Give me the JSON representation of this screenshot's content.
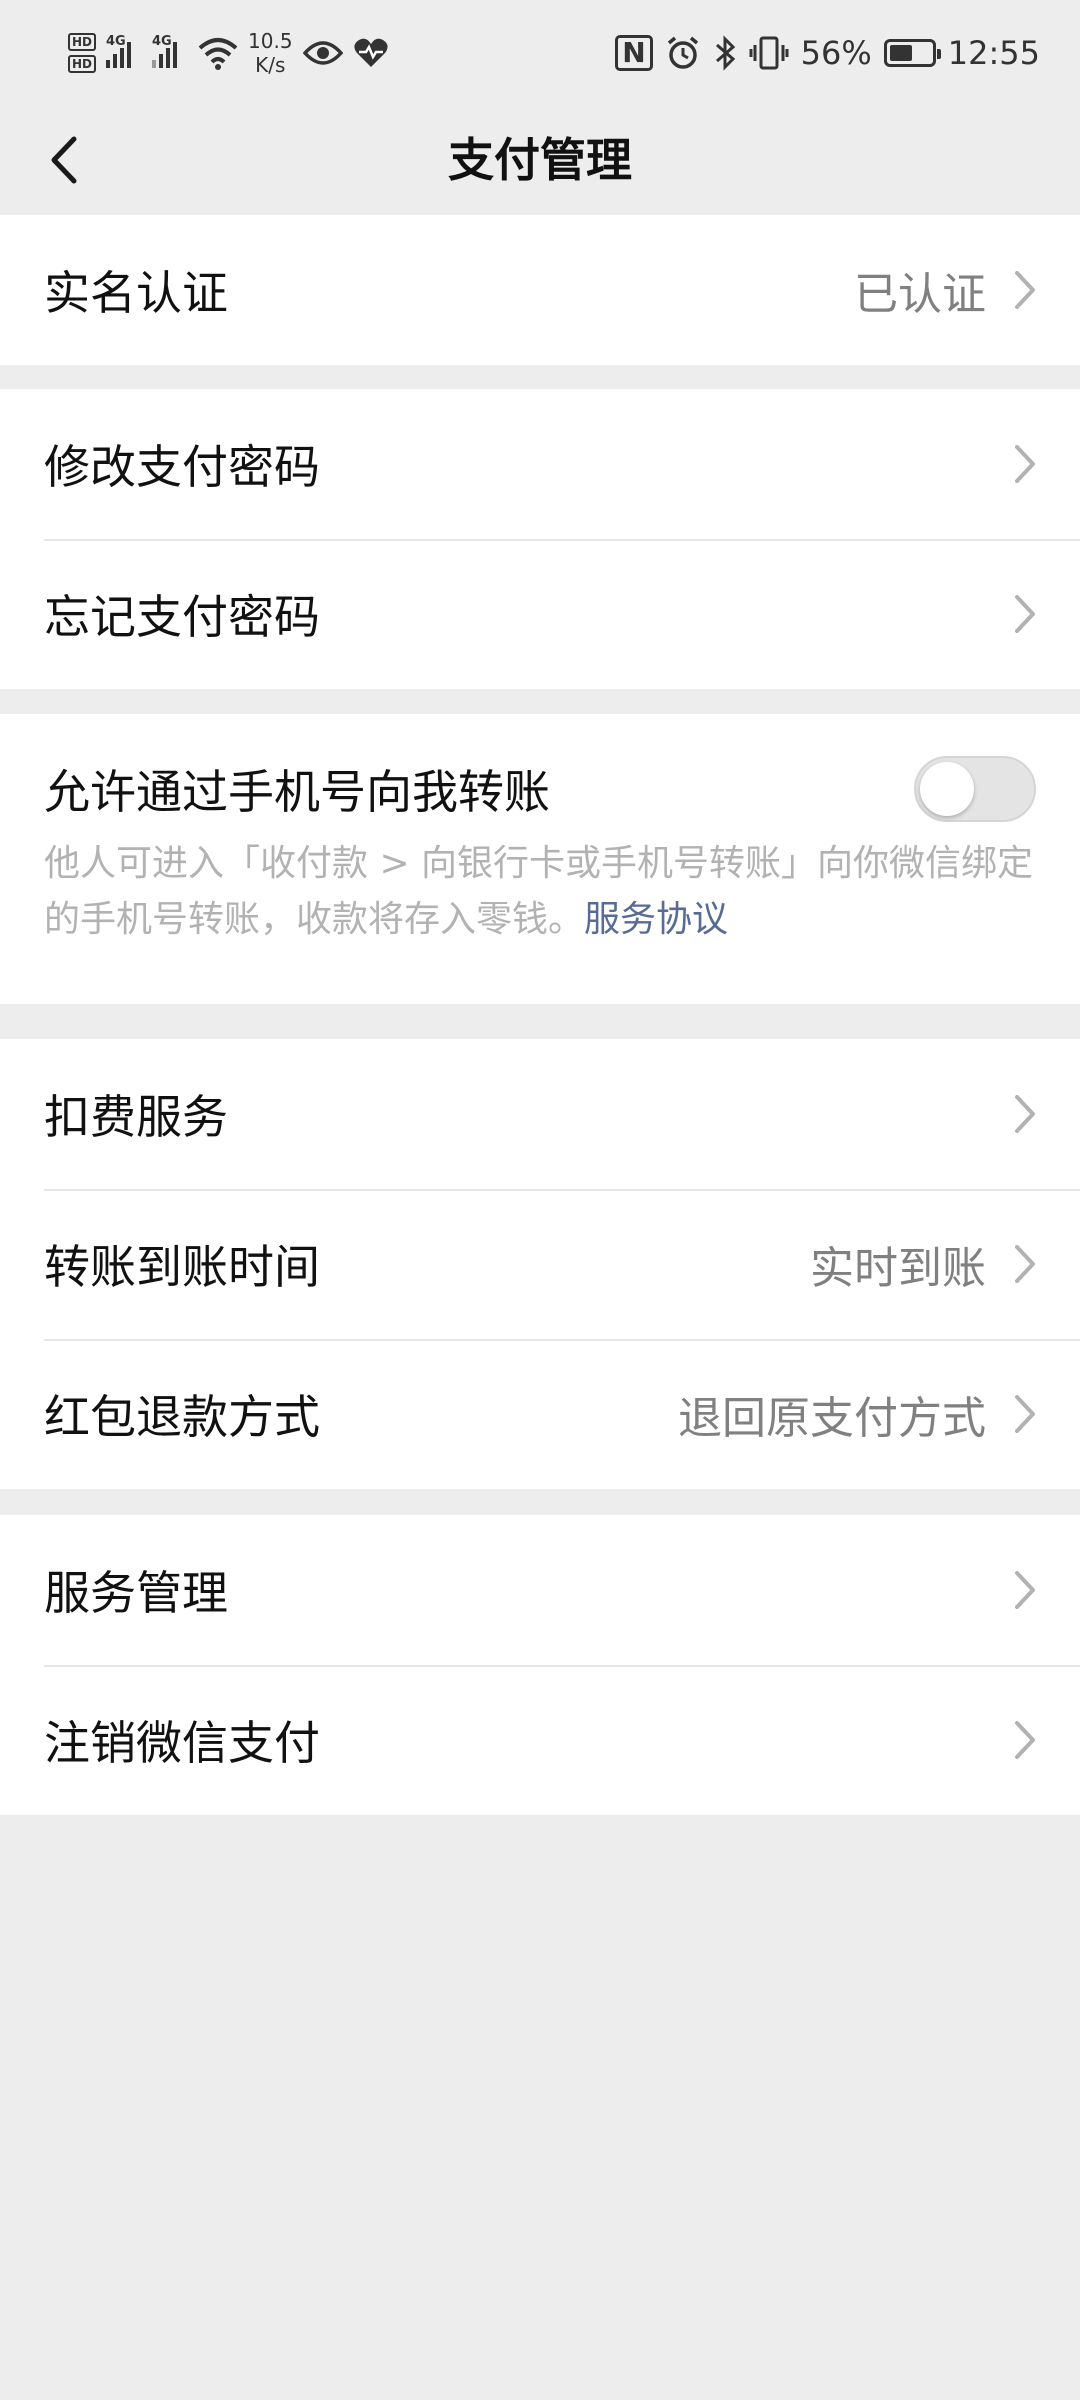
{
  "status_bar": {
    "hd1": "HD",
    "hd2": "HD",
    "net1": "4G",
    "net2": "4G",
    "speed_value": "10.5",
    "speed_unit": "K/s",
    "nfc": "N",
    "battery_percent": "56%",
    "battery_level": 0.56,
    "time": "12:55"
  },
  "header": {
    "title": "支付管理"
  },
  "sections": {
    "identity": {
      "label": "实名认证",
      "value": "已认证"
    },
    "password": {
      "change_label": "修改支付密码",
      "forgot_label": "忘记支付密码"
    },
    "phone_transfer": {
      "label": "允许通过手机号向我转账",
      "enabled": false,
      "description": "他人可进入「收付款 > 向银行卡或手机号转账」向你微信绑定的手机号转账，收款将存入零钱。",
      "link_text": "服务协议"
    },
    "payments": {
      "deduction_label": "扣费服务",
      "arrival_label": "转账到账时间",
      "arrival_value": "实时到账",
      "refund_label": "红包退款方式",
      "refund_value": "退回原支付方式"
    },
    "service": {
      "manage_label": "服务管理",
      "cancel_label": "注销微信支付"
    }
  },
  "colors": {
    "background": "#ededed",
    "link": "#576b95",
    "secondary_text": "#808080"
  }
}
